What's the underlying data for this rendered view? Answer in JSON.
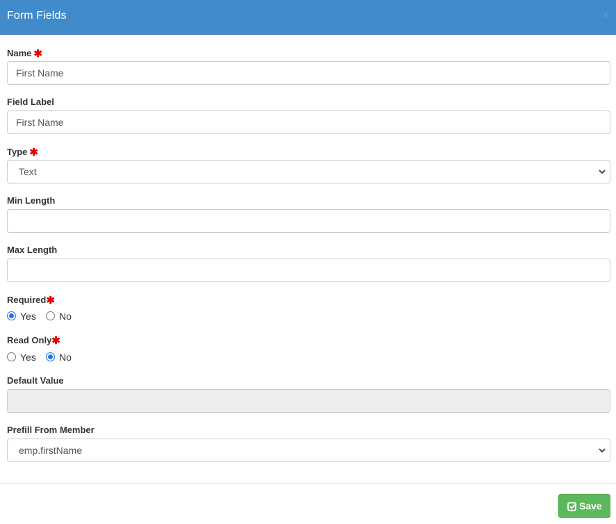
{
  "header": {
    "title": "Form Fields",
    "close_symbol": "×",
    "bg_color": "#428bca"
  },
  "fields": {
    "name": {
      "label": "Name",
      "required_mark": "✱",
      "value": "First Name"
    },
    "field_label": {
      "label": "Field Label",
      "value": "First Name"
    },
    "type": {
      "label": "Type",
      "required_mark": "✱",
      "selected": "Text"
    },
    "min_length": {
      "label": "Min Length",
      "value": ""
    },
    "max_length": {
      "label": "Max Length",
      "value": ""
    },
    "required": {
      "label": "Required",
      "required_mark": "✱",
      "options": [
        "Yes",
        "No"
      ],
      "selected": "Yes"
    },
    "read_only": {
      "label": "Read Only",
      "required_mark": "✱",
      "options": [
        "Yes",
        "No"
      ],
      "selected": "No"
    },
    "default_value": {
      "label": "Default Value",
      "value": "",
      "disabled": true
    },
    "prefill": {
      "label": "Prefill From Member",
      "selected": "emp.firstName"
    }
  },
  "footer": {
    "save_label": "Save",
    "save_color": "#5cb85c",
    "save_icon": "check-square-icon"
  },
  "colors": {
    "required": "#e60000",
    "radio_checked": "#1a73e8"
  }
}
